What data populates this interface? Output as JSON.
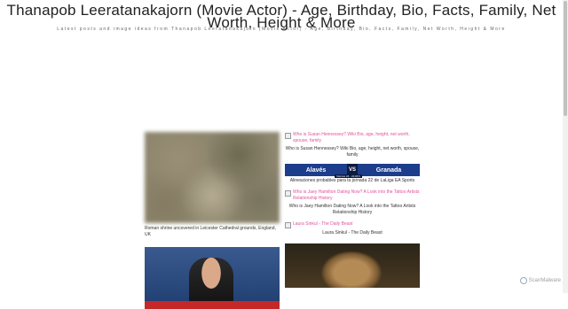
{
  "header": {
    "title": "Thanapob Leeratanakajorn (Movie Actor) - Age, Birthday, Bio, Facts, Family, Net Worth, Height & More",
    "tagline": "Latest posts and image ideas from Thanapob Leeratanakajorn (Movie Actor) - Age, Birthday, Bio, Facts, Family, Net Worth, Height & More"
  },
  "left_column": {
    "items": [
      {
        "caption": "Roman shrine uncovered in Leicester Cathedral grounds, England, UK"
      },
      {
        "caption": ""
      }
    ]
  },
  "right_column": {
    "items": [
      {
        "link": "Who is Susan Hennessey? Wiki Bio, age, height, net worth, spouse, family",
        "caption": "Who is Susan Hennessey? Wiki Bio, age, height, net worth, spouse, family"
      },
      {
        "banner": {
          "home": "Alavés",
          "vs": "VS",
          "away": "Granada",
          "date": "Viernes 24 · 21:00 h"
        },
        "caption": "Alineaciones probables para la jornada 22 de LaLiga EA Sports"
      },
      {
        "link": "Who is Jaey Hamilton Dating Now? A Look into the Tattoo Artists Relationship History",
        "caption": "Who is Jaey Hamilton Dating Now? A Look into the Tattoo Artists Relationship History"
      },
      {
        "link": "Laura Sinkul - The Daily Beast",
        "caption": "Laura Sinkul - The Daily Beast"
      }
    ]
  },
  "watermark": {
    "text": "ScanMalware",
    "icon": "shield-icon"
  },
  "colors": {
    "link": "#e0529b",
    "banner_blue": "#1c3d8c"
  }
}
